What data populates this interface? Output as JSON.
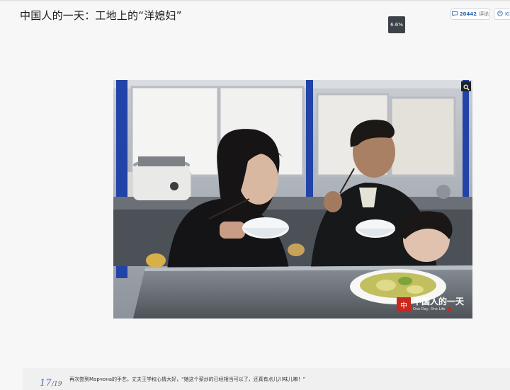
{
  "header": {
    "title": "中国人的一天：工地上的“洋媳妇”",
    "progress": "6.6%",
    "comment_count": "20442",
    "comment_label": "评论",
    "share_label": "KI"
  },
  "photo": {
    "alt": "Photo of a foreign woman and a Chinese man eating rice from bowls at a steel table, with a child beside them",
    "watermark": {
      "title": "中国人的一天",
      "subtitle": "One Day, One Life",
      "tag": ""
    }
  },
  "caption": {
    "page_current": "17",
    "page_total": "/19",
    "text": "再次尝到Марчона的手艺，丈夫王学权心情大好，“她这个菜炒的已经相当可以了，还真有点儿川味儿嘛！”"
  },
  "colors": {
    "accent": "#2e66ad",
    "watermark_red": "#c8281e",
    "badge_bg": "#3c4248"
  }
}
